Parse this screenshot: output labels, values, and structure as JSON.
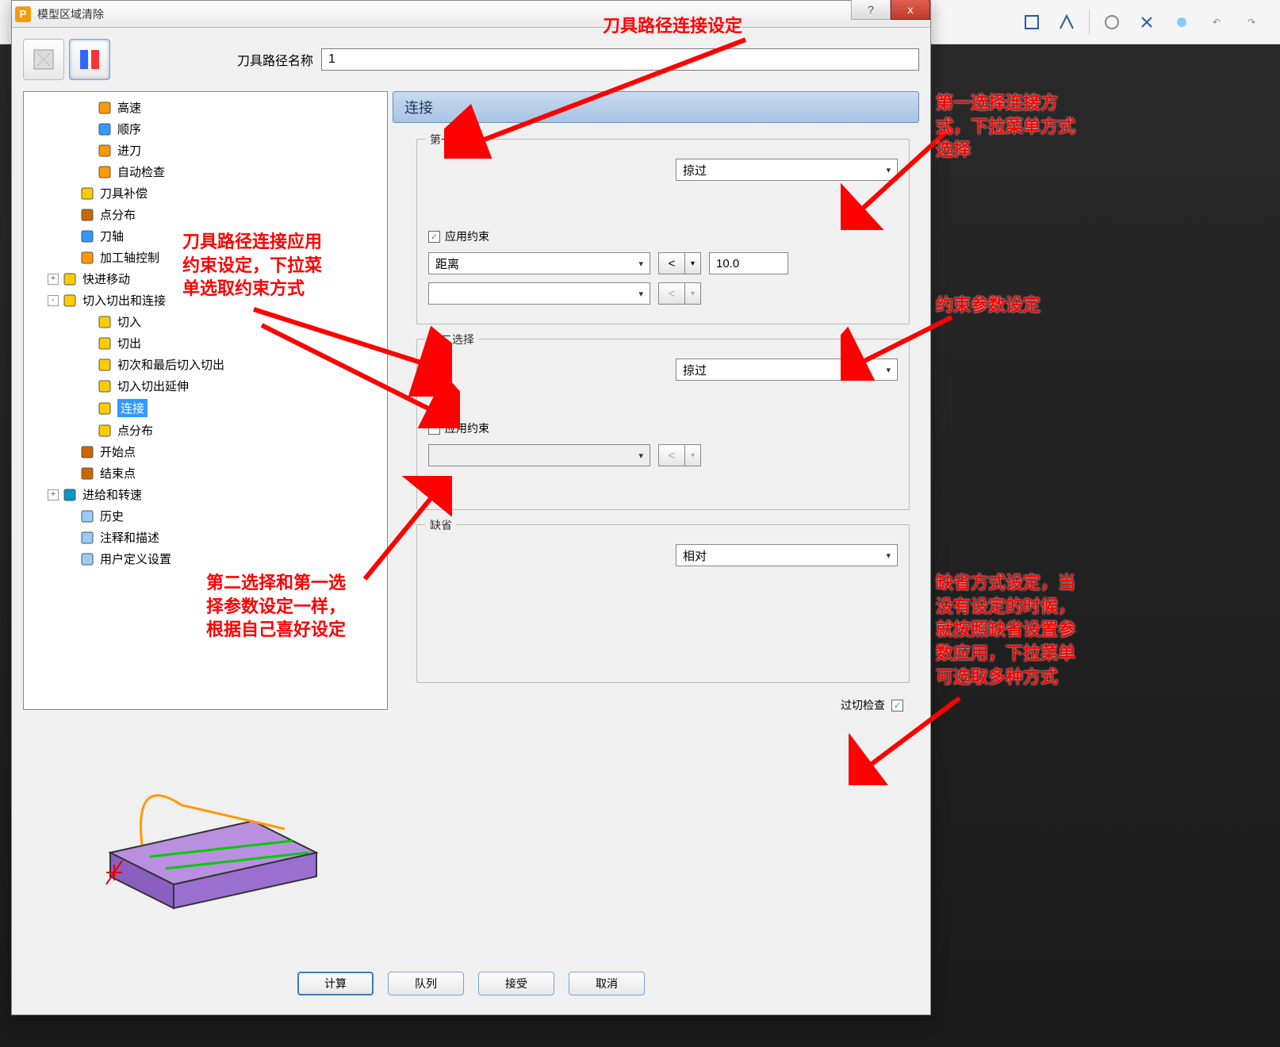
{
  "window": {
    "title": "模型区域清除",
    "help": "?",
    "close": "x"
  },
  "header": {
    "path_label": "刀具路径名称",
    "path_value": "1"
  },
  "tree": [
    {
      "indent": 3,
      "expander": "",
      "icon": "speed",
      "label": "高速"
    },
    {
      "indent": 3,
      "expander": "",
      "icon": "order",
      "label": "顺序"
    },
    {
      "indent": 3,
      "expander": "",
      "icon": "leadin",
      "label": "进刀"
    },
    {
      "indent": 3,
      "expander": "",
      "icon": "autocheck",
      "label": "自动检查"
    },
    {
      "indent": 2,
      "expander": "",
      "icon": "toolcomp",
      "label": "刀具补偿"
    },
    {
      "indent": 2,
      "expander": "",
      "icon": "pointdist",
      "label": "点分布"
    },
    {
      "indent": 2,
      "expander": "",
      "icon": "toolaxis",
      "label": "刀轴"
    },
    {
      "indent": 2,
      "expander": "",
      "icon": "machctrl",
      "label": "加工轴控制"
    },
    {
      "indent": 1,
      "expander": "+",
      "icon": "rapid",
      "label": "快进移动"
    },
    {
      "indent": 1,
      "expander": "-",
      "icon": "leadlink",
      "label": "切入切出和连接"
    },
    {
      "indent": 3,
      "expander": "",
      "icon": "leadin2",
      "label": "切入"
    },
    {
      "indent": 3,
      "expander": "",
      "icon": "leadout",
      "label": "切出"
    },
    {
      "indent": 3,
      "expander": "",
      "icon": "firstlast",
      "label": "初次和最后切入切出"
    },
    {
      "indent": 3,
      "expander": "",
      "icon": "leadext",
      "label": "切入切出延伸"
    },
    {
      "indent": 3,
      "expander": "",
      "icon": "link",
      "label": "连接",
      "selected": true
    },
    {
      "indent": 3,
      "expander": "",
      "icon": "pointdist2",
      "label": "点分布"
    },
    {
      "indent": 2,
      "expander": "",
      "icon": "start",
      "label": "开始点"
    },
    {
      "indent": 2,
      "expander": "",
      "icon": "end",
      "label": "结束点"
    },
    {
      "indent": 1,
      "expander": "+",
      "icon": "feeds",
      "label": "进给和转速"
    },
    {
      "indent": 2,
      "expander": "",
      "icon": "history",
      "label": "历史"
    },
    {
      "indent": 2,
      "expander": "",
      "icon": "notes",
      "label": "注释和描述"
    },
    {
      "indent": 2,
      "expander": "",
      "icon": "usersettings",
      "label": "用户定义设置"
    }
  ],
  "content": {
    "header": "连接",
    "section1": {
      "label": "第一选择",
      "dropdown1": "掠过",
      "apply_constraint_label": "应用约束",
      "apply_constraint_checked": true,
      "constraint_type": "距离",
      "constraint_op": "<",
      "constraint_value": "10.0",
      "constraint_type2": "",
      "constraint_op2": "<"
    },
    "section2": {
      "label": "第二选择",
      "dropdown1": "掠过",
      "apply_constraint_label": "应用约束",
      "apply_constraint_checked": false,
      "constraint_type": "",
      "constraint_op": "<"
    },
    "section3": {
      "label": "缺省",
      "dropdown1": "相对"
    },
    "gouge_check_label": "过切检查",
    "gouge_check_checked": true
  },
  "footer": {
    "calc": "计算",
    "queue": "队列",
    "accept": "接受",
    "cancel": "取消"
  },
  "annotations": {
    "top": "刀具路径连接设定",
    "top_right": "第一选择连接方\n式，下拉菜单方式\n选择",
    "mid_right": "约束参数设定",
    "left_red": "刀具路径连接应用\n约束设定，下拉菜\n单选取约束方式",
    "section2_red": "第二选择和第一选\n择参数设定一样，\n根据自己喜好设定",
    "bottom_right": "缺省方式设定，当\n没有设定的时候，\n就按照缺省设置参\n数应用，下拉菜单\n可选取多种方式"
  }
}
